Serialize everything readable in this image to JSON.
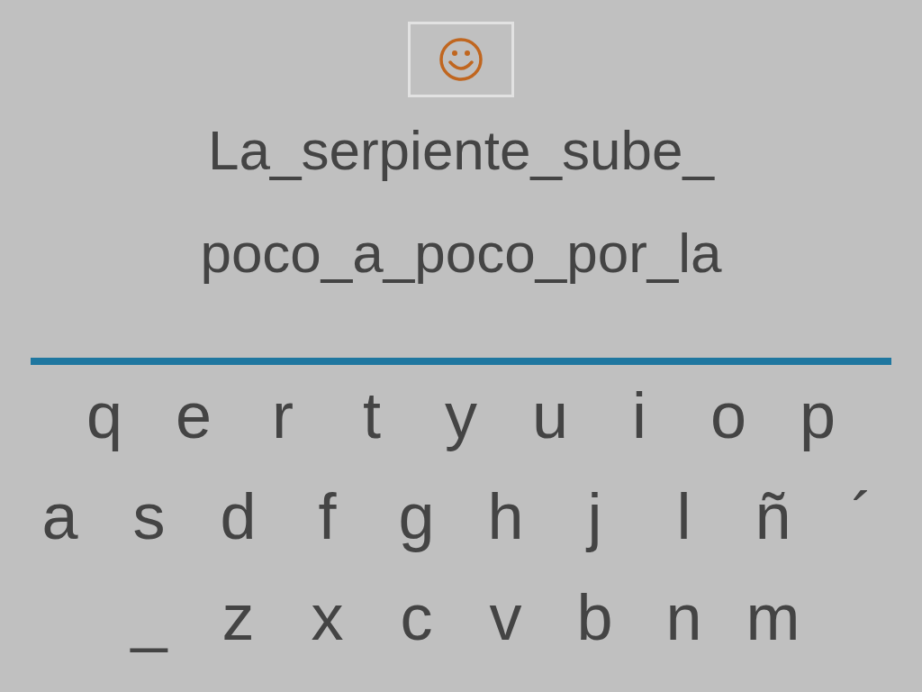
{
  "sentence_lines": [
    "La_serpiente_sube_",
    "poco_a_poco_por_la"
  ],
  "keyboard_rows": [
    [
      "q",
      "e",
      "r",
      "t",
      "y",
      "u",
      "i",
      "o",
      "p"
    ],
    [
      "a",
      "s",
      "d",
      "f",
      "g",
      "h",
      "j",
      "l",
      "ñ",
      "´"
    ],
    [
      "_",
      "z",
      "x",
      "c",
      "v",
      "b",
      "n",
      "m"
    ]
  ]
}
